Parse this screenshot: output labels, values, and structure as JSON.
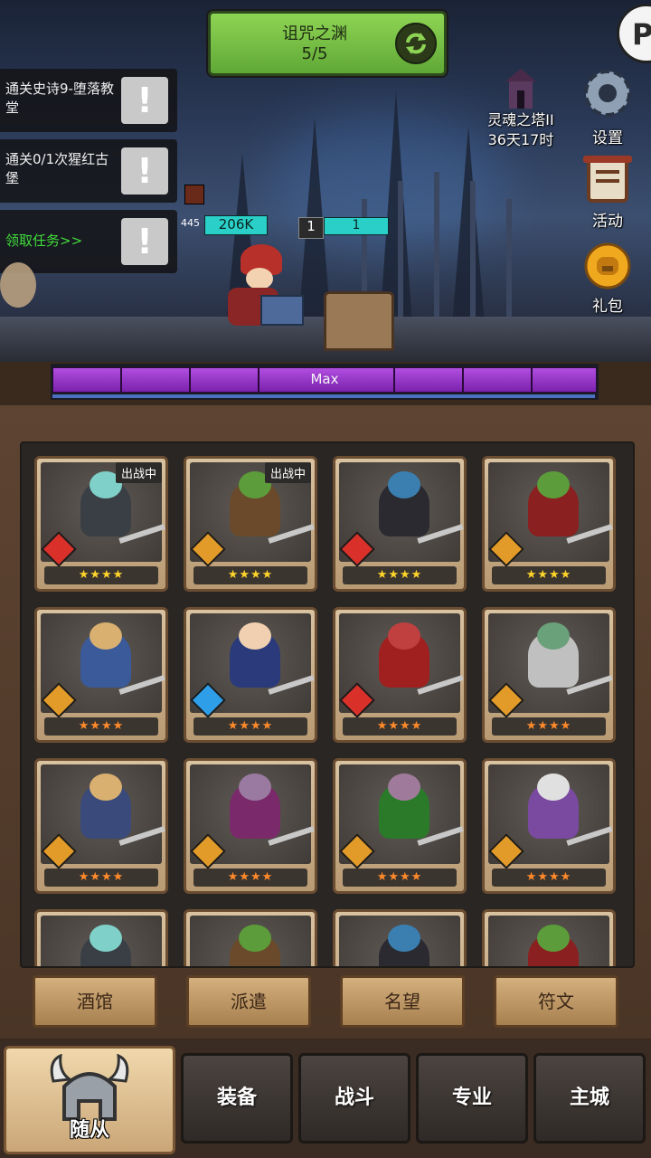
{
  "dungeon": {
    "name": "诅咒之渊",
    "progress": "5/5"
  },
  "quests": [
    {
      "text": "通关史诗9-堕落教堂",
      "highlight": false
    },
    {
      "text": "通关0/1次猩红古堡",
      "highlight": false
    },
    {
      "text": "领取任务>>",
      "highlight": true
    }
  ],
  "quest_badge_glyph": "!",
  "tower": {
    "name": "灵魂之塔II",
    "timer": "36天17时"
  },
  "side_buttons": {
    "settings": "设置",
    "events": "活动",
    "gift": "礼包"
  },
  "battle": {
    "hero_power": "445",
    "hero_hp": "206K",
    "enemy_level": "1",
    "enemy_hp": "1"
  },
  "max_bar": {
    "label": "Max",
    "progress": 1.0
  },
  "heroes": [
    {
      "status": "出战中",
      "stars": "★★★★",
      "star_color": "gold",
      "rarity": "red"
    },
    {
      "status": "出战中",
      "stars": "★★★★",
      "star_color": "gold",
      "rarity": "orange"
    },
    {
      "status": "",
      "stars": "★★★★",
      "star_color": "gold",
      "rarity": "red"
    },
    {
      "status": "",
      "stars": "★★★★",
      "star_color": "gold",
      "rarity": "orange"
    },
    {
      "status": "",
      "stars": "★★★★",
      "star_color": "orange",
      "rarity": "orange"
    },
    {
      "status": "",
      "stars": "★★★★",
      "star_color": "orange",
      "rarity": "blue"
    },
    {
      "status": "",
      "stars": "★★★★",
      "star_color": "orange",
      "rarity": "red"
    },
    {
      "status": "",
      "stars": "★★★★",
      "star_color": "orange",
      "rarity": "orange"
    },
    {
      "status": "",
      "stars": "★★★★",
      "star_color": "orange",
      "rarity": "orange"
    },
    {
      "status": "",
      "stars": "★★★★",
      "star_color": "orange",
      "rarity": "orange"
    },
    {
      "status": "",
      "stars": "★★★★",
      "star_color": "orange",
      "rarity": "orange"
    },
    {
      "status": "",
      "stars": "★★★★",
      "star_color": "orange",
      "rarity": "orange"
    }
  ],
  "action_buttons": {
    "tavern": "酒馆",
    "dispatch": "派遣",
    "reputation": "名望",
    "runes": "符文"
  },
  "nav": {
    "followers": "随从",
    "equipment": "装备",
    "battle": "战斗",
    "profession": "专业",
    "main_city": "主城"
  },
  "colors": {
    "accent_green": "#6fbe3e",
    "hp_cyan": "#2ad0c8",
    "max_purple": "#9a3dc9"
  }
}
